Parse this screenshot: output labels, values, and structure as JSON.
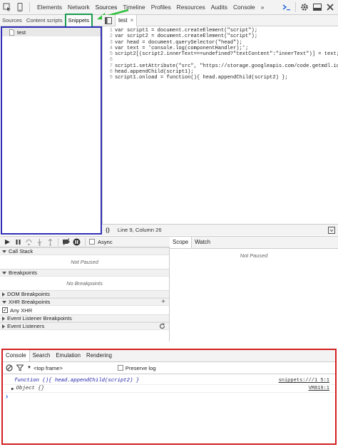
{
  "toolbar": {
    "tabs": [
      "Elements",
      "Network",
      "Sources",
      "Timeline",
      "Profiles",
      "Resources",
      "Audits",
      "Console"
    ],
    "more": "»"
  },
  "navigator": {
    "tabs": [
      "Sources",
      "Content scripts",
      "Snippets"
    ],
    "snippet_item": "test"
  },
  "editor": {
    "tab_label": "test",
    "tab_close": "×",
    "lines": [
      {
        "n": "1",
        "code": "var script1 = document.createElement(\"script\");"
      },
      {
        "n": "2",
        "code": "var script2 = document.createElement(\"script\");"
      },
      {
        "n": "3",
        "code": "var head = document.querySelector(\"head\");"
      },
      {
        "n": "4",
        "code": "var text = 'console.log(componentHandler);';"
      },
      {
        "n": "5",
        "code": "script2[(script2.innerText===undefined?\"textContent\":\"innerText\")] = text;"
      },
      {
        "n": "6",
        "code": ""
      },
      {
        "n": "7",
        "code": "script1.setAttribute(\"src\", \"https://storage.googleapis.com/code.getmdl.io/1."
      },
      {
        "n": "8",
        "code": "head.appendChild(script1);"
      },
      {
        "n": "9",
        "code": "script1.onload = function(){ head.appendChild(script2) };"
      }
    ],
    "status_braces": "{}",
    "status_position": "Line 9, Column 26"
  },
  "debugger": {
    "async_label": "Async",
    "call_stack": "Call Stack",
    "call_stack_info": "Not Paused",
    "breakpoints": "Breakpoints",
    "breakpoints_info": "No Breakpoints",
    "dom_breakpoints": "DOM Breakpoints",
    "xhr_breakpoints": "XHR Breakpoints",
    "xhr_add": "+",
    "any_xhr": "Any XHR",
    "event_listener_breakpoints": "Event Listener Breakpoints",
    "event_listeners": "Event Listeners"
  },
  "scope": {
    "tabs": [
      "Scope",
      "Watch"
    ],
    "info": "Not Paused"
  },
  "console": {
    "tabs": [
      "Console",
      "Search",
      "Emulation",
      "Rendering"
    ],
    "frame_select": "<top frame>",
    "preserve_log": "Preserve log",
    "entries": [
      {
        "text": "function (){ head.appendChild(script2) }",
        "source": "snippets:///1 5:1"
      },
      {
        "text": "Object {}",
        "source": "VM819:1"
      }
    ],
    "prompt": "›"
  },
  "colors": {
    "snippets_highlight": "#1a9a4f",
    "navigator_border": "#2e2eb8",
    "console_border": "#d21f1f",
    "arrow": "#2fbf3a",
    "active_tab_text": "#222222"
  }
}
